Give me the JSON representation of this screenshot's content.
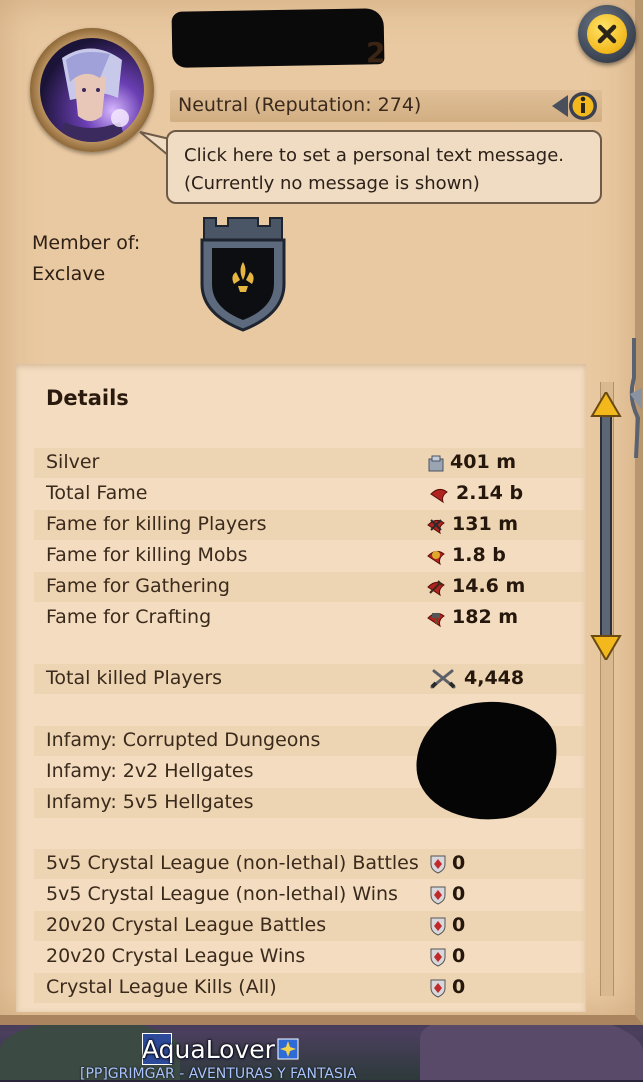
{
  "profile": {
    "name_suffix": "2",
    "reputation_text": "Neutral (Reputation: 274)",
    "message_line1": "Click here to set a personal text message.",
    "message_line2": "(Currently no message is shown)",
    "member_label_line1": "Member of:",
    "member_label_line2": "Exclave"
  },
  "icons": {
    "close": "close-icon",
    "info": "info-icon",
    "guild_shield": "guild-crest-icon"
  },
  "details": {
    "title": "Details",
    "stats": [
      {
        "label": "Silver",
        "value": "401 m",
        "icon": "silver-icon"
      },
      {
        "label": "Total Fame",
        "value": "2.14 b",
        "icon": "fame-icon"
      },
      {
        "label": "Fame for killing Players",
        "value": "131 m",
        "icon": "pvp-fame-icon"
      },
      {
        "label": "Fame for killing Mobs",
        "value": "1.8 b",
        "icon": "pve-fame-icon"
      },
      {
        "label": "Fame for Gathering",
        "value": "14.6 m",
        "icon": "gathering-fame-icon"
      },
      {
        "label": "Fame for Crafting",
        "value": "182 m",
        "icon": "crafting-fame-icon"
      }
    ],
    "kills": {
      "label": "Total killed Players",
      "value": "4,448",
      "icon": "crossed-swords-icon"
    },
    "infamy": [
      {
        "label": "Infamy: Corrupted Dungeons"
      },
      {
        "label": "Infamy: 2v2 Hellgates"
      },
      {
        "label": "Infamy: 5v5 Hellgates"
      }
    ],
    "crystal": [
      {
        "label": "5v5 Crystal League (non-lethal) Battles",
        "value": "0"
      },
      {
        "label": "5v5 Crystal League (non-lethal) Wins",
        "value": "0"
      },
      {
        "label": "20v20 Crystal League Battles",
        "value": "0"
      },
      {
        "label": "20v20 Crystal League Wins",
        "value": "0"
      },
      {
        "label": "Crystal League Kills (All)",
        "value": "0"
      }
    ]
  },
  "nameplate": {
    "player_name": "AquaLover",
    "guild": "[PP]GRIMGAR - AVENTURAS Y FANTASIA"
  },
  "colors": {
    "parchment": "#e9c9a1",
    "details_bg": "#f3dcbf",
    "text_dark": "#2a1a0e",
    "accent_gold": "#f2b81c",
    "fame_red": "#b0231f"
  }
}
